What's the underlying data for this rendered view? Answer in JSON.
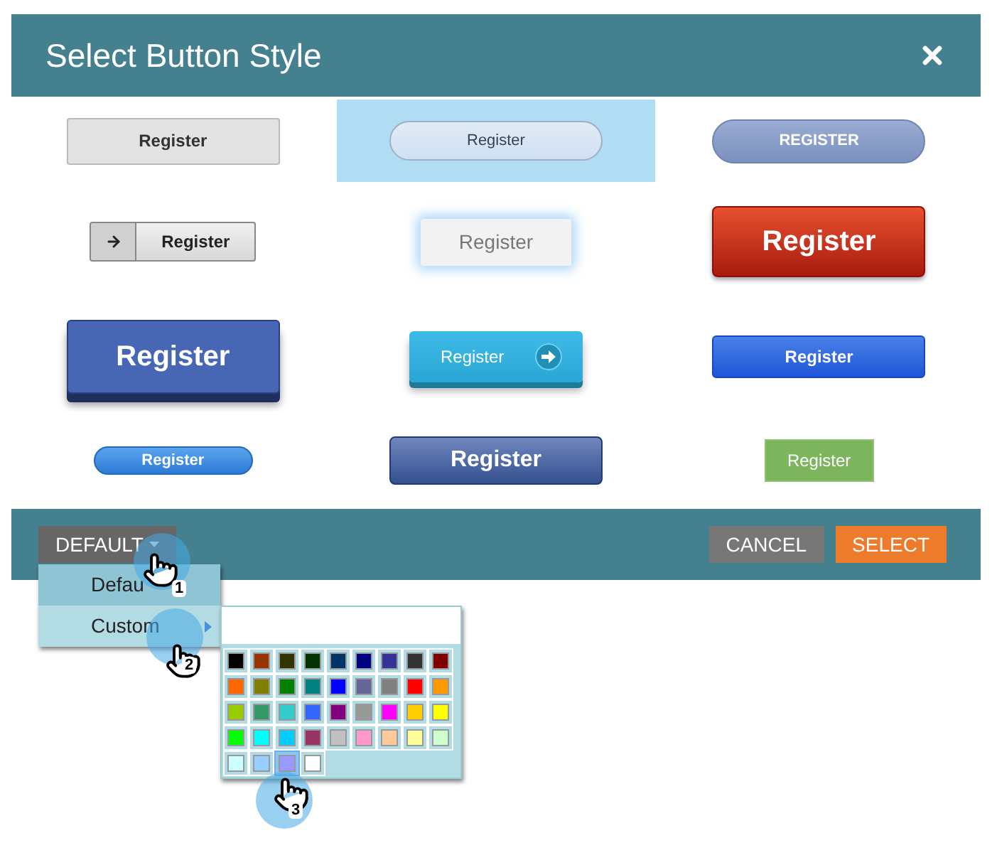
{
  "dialog": {
    "title": "Select Button Style"
  },
  "button_styles": [
    {
      "kind": "flat-gray",
      "label": "Register",
      "selected": false
    },
    {
      "kind": "pill-light",
      "label": "Register",
      "selected": true
    },
    {
      "kind": "pill-slate",
      "label": "REGISTER",
      "selected": false
    },
    {
      "kind": "arrow-gray",
      "label": "Register",
      "selected": false
    },
    {
      "kind": "glow",
      "label": "Register",
      "selected": false
    },
    {
      "kind": "red-glossy",
      "label": "Register",
      "selected": false
    },
    {
      "kind": "blue-3d",
      "label": "Register",
      "selected": false
    },
    {
      "kind": "cyan-arrow",
      "label": "Register",
      "selected": false
    },
    {
      "kind": "blue-flat",
      "label": "Register",
      "selected": false
    },
    {
      "kind": "small-pill",
      "label": "Register",
      "selected": false
    },
    {
      "kind": "navy-glossy",
      "label": "Register",
      "selected": false
    },
    {
      "kind": "green",
      "label": "Register",
      "selected": false
    }
  ],
  "footer": {
    "style_dropdown": {
      "label": "DEFAULT"
    },
    "buttons": [
      {
        "kind": "secondary",
        "label": "CANCEL"
      },
      {
        "kind": "primary",
        "label": "SELECT"
      }
    ]
  },
  "style_menu": {
    "items": [
      {
        "label": "Defau",
        "selected": true,
        "has_submenu": false
      },
      {
        "label": "Custom",
        "selected": false,
        "has_submenu": true
      }
    ]
  },
  "color_picker": {
    "rows": [
      {
        "swatches": [
          {
            "color": "#000000",
            "selected": false
          },
          {
            "color": "#993300",
            "selected": false
          },
          {
            "color": "#333300",
            "selected": false
          },
          {
            "color": "#003300",
            "selected": false
          },
          {
            "color": "#003366",
            "selected": false
          },
          {
            "color": "#000080",
            "selected": false
          },
          {
            "color": "#333399",
            "selected": false
          },
          {
            "color": "#333333",
            "selected": false
          },
          {
            "color": "#800000",
            "selected": false
          }
        ]
      },
      {
        "swatches": [
          {
            "color": "#ff6600",
            "selected": false
          },
          {
            "color": "#808000",
            "selected": false
          },
          {
            "color": "#008000",
            "selected": false
          },
          {
            "color": "#008080",
            "selected": false
          },
          {
            "color": "#0000ff",
            "selected": false
          },
          {
            "color": "#666699",
            "selected": false
          },
          {
            "color": "#808080",
            "selected": false
          },
          {
            "color": "#ff0000",
            "selected": false
          },
          {
            "color": "#ff9900",
            "selected": false
          }
        ]
      },
      {
        "swatches": [
          {
            "color": "#99cc00",
            "selected": false
          },
          {
            "color": "#339966",
            "selected": false
          },
          {
            "color": "#33cccc",
            "selected": false
          },
          {
            "color": "#3366ff",
            "selected": false
          },
          {
            "color": "#800080",
            "selected": false
          },
          {
            "color": "#999999",
            "selected": false
          },
          {
            "color": "#ff00ff",
            "selected": false
          },
          {
            "color": "#ffcc00",
            "selected": false
          },
          {
            "color": "#ffff00",
            "selected": false
          }
        ]
      },
      {
        "swatches": [
          {
            "color": "#00ff00",
            "selected": false
          },
          {
            "color": "#00ffff",
            "selected": false
          },
          {
            "color": "#00ccff",
            "selected": false
          },
          {
            "color": "#993366",
            "selected": false
          },
          {
            "color": "#c0c0c0",
            "selected": false
          },
          {
            "color": "#ff99cc",
            "selected": false
          },
          {
            "color": "#ffcc99",
            "selected": false
          },
          {
            "color": "#ffff99",
            "selected": false
          },
          {
            "color": "#ccffcc",
            "selected": false
          }
        ]
      },
      {
        "swatches": [
          {
            "color": "#ccffff",
            "selected": false
          },
          {
            "color": "#99ccff",
            "selected": false
          },
          {
            "color": "#9999ff",
            "selected": true
          },
          {
            "color": "#ffffff",
            "selected": false
          }
        ]
      }
    ]
  },
  "callouts": [
    {
      "label": "1"
    },
    {
      "label": "2"
    },
    {
      "label": "3"
    }
  ]
}
